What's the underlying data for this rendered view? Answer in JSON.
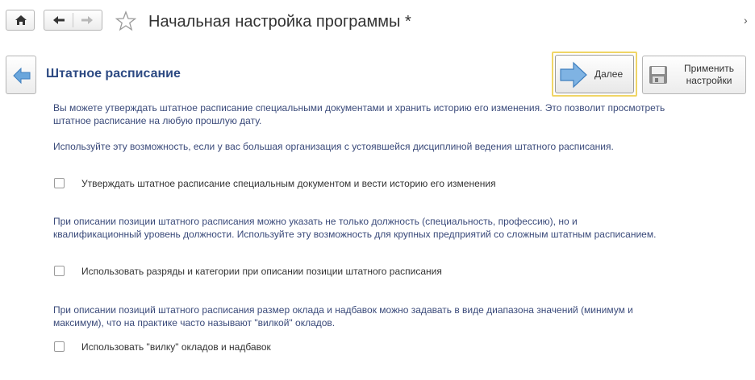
{
  "window": {
    "title": "Начальная настройка программы *"
  },
  "toolbar": {
    "next_label": "Далее",
    "apply_label": "Применить настройки"
  },
  "section": {
    "title": "Штатное расписание"
  },
  "paragraphs": [
    "Вы можете утверждать штатное расписание специальными документами и хранить историю его изменения. Это позволит просмотреть штатное расписание на любую прошлую дату.",
    "Используйте эту возможность, если у вас большая организация с устоявшейся дисциплиной ведения штатного расписания.",
    "При описании позиции штатного расписания можно указать не только должность (специальность, профессию), но и квалификационный уровень должности. Используйте эту возможность для крупных предприятий со сложным штатным расписанием.",
    "При описании позиций штатного расписания размер оклада и надбавок можно задавать в виде диапазона значений (минимум и максимум), что на практике часто называют \"вилкой\" окладов."
  ],
  "checkboxes": [
    {
      "label": "Утверждать штатное расписание специальным документом и вести историю его изменения",
      "checked": false
    },
    {
      "label": "Использовать разряды и категории при описании позиции штатного расписания",
      "checked": false
    },
    {
      "label": "Использовать \"вилку\" окладов и надбавок",
      "checked": false
    }
  ],
  "colors": {
    "accent_title": "#2d4a83",
    "body_text": "#3a4a7a",
    "arrow_blue": "#5b9bd5",
    "focus_yellow": "#f0d566"
  }
}
